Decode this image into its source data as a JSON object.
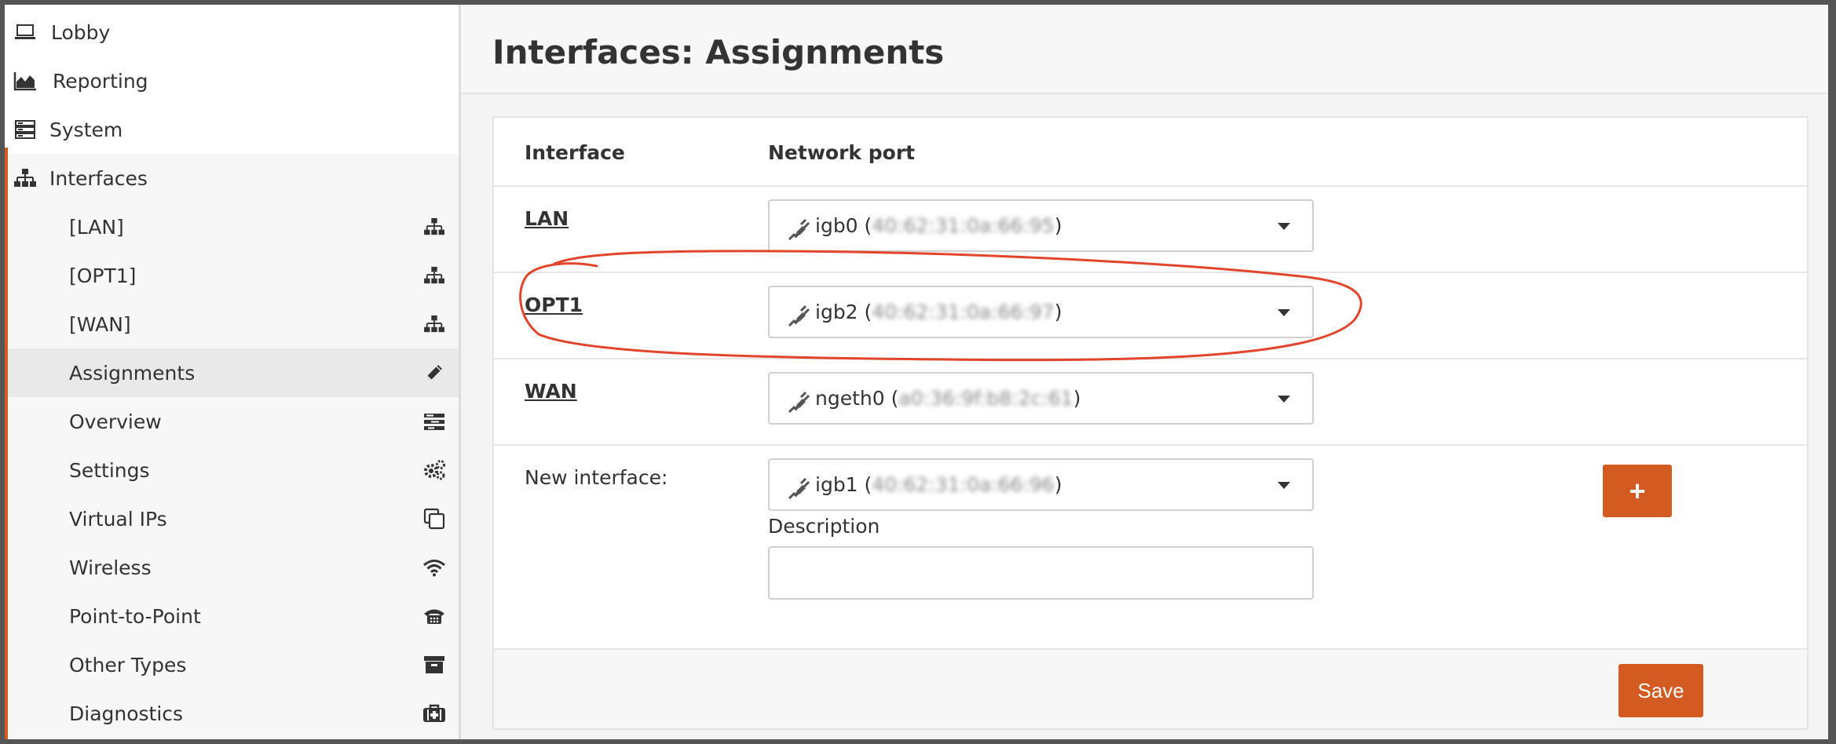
{
  "sidebar": {
    "top_items": [
      {
        "label": "Lobby",
        "icon": "laptop-icon"
      },
      {
        "label": "Reporting",
        "icon": "area-chart-icon"
      },
      {
        "label": "System",
        "icon": "server-icon"
      },
      {
        "label": "Interfaces",
        "icon": "sitemap-icon"
      }
    ],
    "sub_items": [
      {
        "label": "[LAN]",
        "icon": "sitemap-icon"
      },
      {
        "label": "[OPT1]",
        "icon": "sitemap-icon"
      },
      {
        "label": "[WAN]",
        "icon": "sitemap-icon"
      },
      {
        "label": "Assignments",
        "icon": "pencil-icon",
        "active": true
      },
      {
        "label": "Overview",
        "icon": "tasks-icon"
      },
      {
        "label": "Settings",
        "icon": "cogs-icon"
      },
      {
        "label": "Virtual IPs",
        "icon": "clone-icon"
      },
      {
        "label": "Wireless",
        "icon": "wifi-icon"
      },
      {
        "label": "Point-to-Point",
        "icon": "fax-icon"
      },
      {
        "label": "Other Types",
        "icon": "archive-icon"
      },
      {
        "label": "Diagnostics",
        "icon": "medkit-icon"
      }
    ]
  },
  "page": {
    "title": "Interfaces: Assignments"
  },
  "table": {
    "headers": {
      "interface": "Interface",
      "port": "Network port"
    },
    "rows": [
      {
        "name": "LAN",
        "port_prefix": "igb0 (",
        "port_blurred": "40:62:31:0a:66:95",
        "port_suffix": ")"
      },
      {
        "name": "OPT1",
        "port_prefix": "igb2 (",
        "port_blurred": "40:62:31:0a:66:97",
        "port_suffix": ")"
      },
      {
        "name": "WAN",
        "port_prefix": "ngeth0 (",
        "port_blurred": "a0:36:9f:b8:2c:61",
        "port_suffix": ")"
      }
    ],
    "new_interface": {
      "label": "New interface:",
      "port_prefix": "igb1 (",
      "port_blurred": "40:62:31:0a:66:96",
      "port_suffix": ")",
      "description_label": "Description",
      "description_value": "",
      "add_label": "+"
    },
    "save_label": "Save"
  },
  "colors": {
    "accent": "#d35b22",
    "annotation": "#e2452b"
  }
}
